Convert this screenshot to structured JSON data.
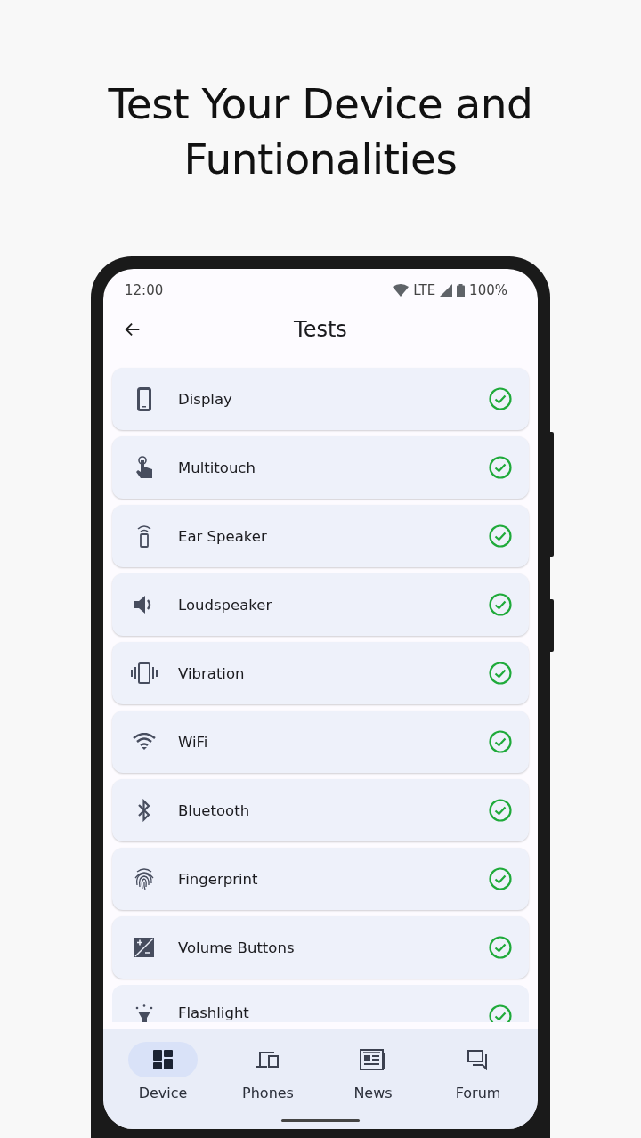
{
  "headline": "Test Your Device and Funtionalities",
  "status_bar": {
    "time": "12:00",
    "network": "LTE",
    "battery": "100%"
  },
  "app_bar": {
    "title": "Tests"
  },
  "tests": [
    {
      "kind": "display",
      "label": "Display",
      "passed": true
    },
    {
      "kind": "touch",
      "label": "Multitouch",
      "passed": true
    },
    {
      "kind": "ear",
      "label": "Ear Speaker",
      "passed": true
    },
    {
      "kind": "speaker",
      "label": "Loudspeaker",
      "passed": true
    },
    {
      "kind": "vibration",
      "label": "Vibration",
      "passed": true
    },
    {
      "kind": "wifi",
      "label": "WiFi",
      "passed": true
    },
    {
      "kind": "bluetooth",
      "label": "Bluetooth",
      "passed": true
    },
    {
      "kind": "fingerprint",
      "label": "Fingerprint",
      "passed": true
    },
    {
      "kind": "volume",
      "label": "Volume Buttons",
      "passed": true
    },
    {
      "kind": "flashlight",
      "label": "Flashlight",
      "passed": true
    }
  ],
  "bottom_nav": [
    {
      "kind": "device",
      "label": "Device",
      "selected": true
    },
    {
      "kind": "phones",
      "label": "Phones",
      "selected": false
    },
    {
      "kind": "news",
      "label": "News",
      "selected": false
    },
    {
      "kind": "forum",
      "label": "Forum",
      "selected": false
    }
  ]
}
